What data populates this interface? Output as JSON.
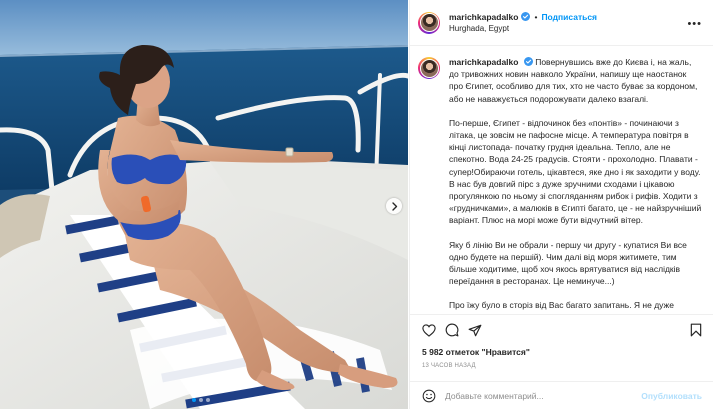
{
  "post": {
    "username": "marichkapadalko",
    "follow_label": "Подписаться",
    "separator": "•",
    "location": "Hurghada, Egypt",
    "more_label": "•••"
  },
  "caption": {
    "username": "marichkapadalko",
    "paragraphs": [
      "Повернувшись вже до Києва і, на жаль, до тривожних новин навколо України, напишу ще наостанок про Єгипет, особливо для тих, хто не часто буває за кордоном, або не наважується подорожувати далеко взагалі.",
      "По-перше, Єгипет - відпочинок без «понтів» - починаючи з літака, це зовсім не пафосне місце. А температура повітря в кінці листопада- початку грудня ідеальна. Тепло, але не спекотно. Вода 24-25 градусів. Стояти - прохолодно. Плавати - супер!Обираючи готель, цікавтеся, яке дно і як заходити у воду. В нас був довгий пірс з дуже зручними сходами і цікавою прогулянкою по ньому зі спогляданням рибок і рифів. Ходити з «грудничками», а малюків в Єгипті багато, це - не найзручніший варіант. Плюс на морі може бути відчутний вітер.",
      "Яку б лінію Ви не обрали - першу чи другу - купатися Ви все одно будете на першій). Чим далі від моря житимете, тим більше ходитиме, щоб хоч якось врятуватися від наслідків переїдання в ресторанах. Це неминуче...)",
      "Про їжу було в сторіз від Вас багато запитань. Я не дуже вибаглива, щоб зрозуміти, що означає «нам не подобається їжа», коли я це чула від гостей готелю, бо для мене їжа, яку я НЕ"
    ]
  },
  "stats": {
    "likes": "5 982 отметок \"Нравится\"",
    "time": "13 ЧАСОВ НАЗАД"
  },
  "comment": {
    "placeholder": "Добавьте комментарий...",
    "publish_label": "Опубликовать"
  },
  "carousel": {
    "slides": 3,
    "active_index": 0
  },
  "colors": {
    "accent": "#0095f6",
    "text": "#262626",
    "muted": "#8e8e8e",
    "border": "#efefef"
  },
  "icons": [
    "emoji-icon",
    "heart-icon",
    "comment-icon",
    "share-icon",
    "save-icon",
    "verified-icon",
    "chevron-right-icon"
  ]
}
